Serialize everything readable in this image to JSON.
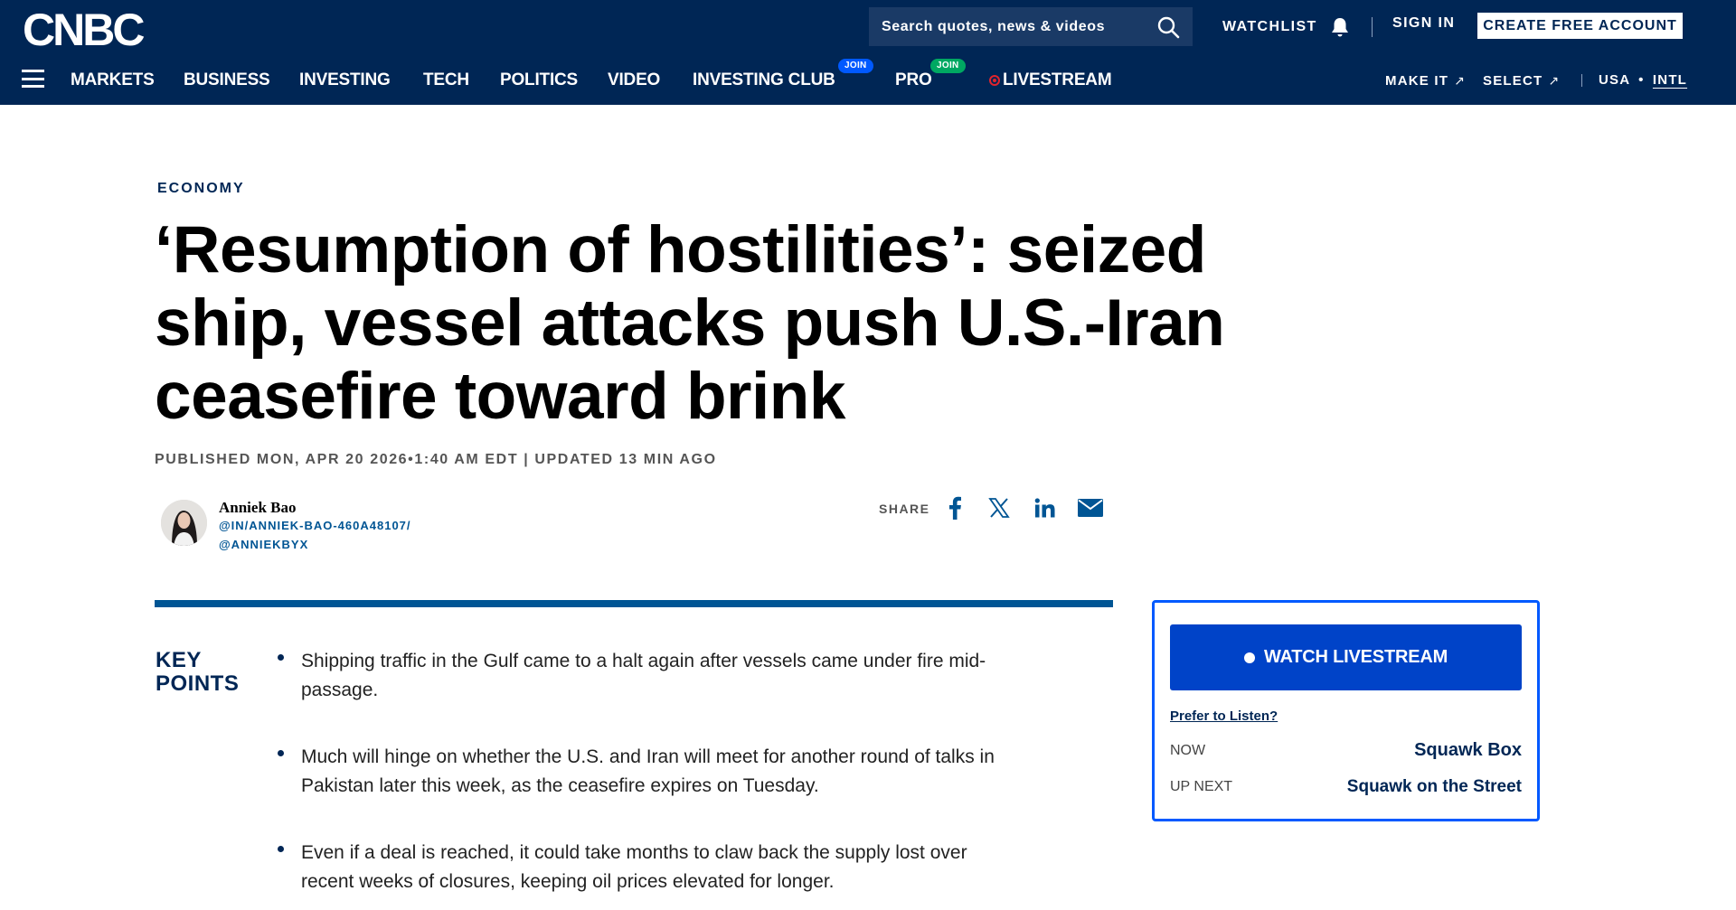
{
  "header": {
    "logo": "CNBC",
    "search": {
      "placeholder": "Search quotes, news & videos",
      "value": ""
    },
    "watchlist_label": "WATCHLIST",
    "signin_label": "SIGN IN",
    "create_account_label": "CREATE FREE ACCOUNT"
  },
  "nav": {
    "items": [
      {
        "label": "MARKETS"
      },
      {
        "label": "BUSINESS"
      },
      {
        "label": "INVESTING"
      },
      {
        "label": "TECH"
      },
      {
        "label": "POLITICS"
      },
      {
        "label": "VIDEO"
      },
      {
        "label": "INVESTING CLUB",
        "badge": "JOIN"
      },
      {
        "label": "PRO",
        "badge": "JOIN"
      },
      {
        "label": "LIVESTREAM"
      }
    ],
    "right": {
      "make_it": "MAKE IT",
      "select": "SELECT",
      "usa": "USA",
      "separator": "•",
      "intl": "INTL"
    }
  },
  "article": {
    "section": "ECONOMY",
    "headline_lines": [
      "‘Resumption of hostilities’: seized",
      "ship, vessel attacks push U.S.-Iran",
      "ceasefire toward brink"
    ],
    "timestamp": "PUBLISHED MON, APR 20 2026•1:40 AM EDT | UPDATED 13 MIN AGO",
    "author": {
      "name": "Anniek Bao",
      "linkedin": "@IN/ANNIEK-BAO-460A48107/",
      "twitter": "@ANNIEKBYX"
    },
    "share_label": "SHARE",
    "key_points_title_1": "KEY",
    "key_points_title_2": "POINTS",
    "key_points": [
      {
        "line1": "Shipping traffic in the Gulf came to a halt again after vessels came under fire mid-",
        "line2": "passage."
      },
      {
        "line1": "Much will hinge on whether the U.S. and Iran will meet for another round of talks in",
        "line2": "Pakistan later this week, as the ceasefire expires on Tuesday."
      },
      {
        "line1": "Even if a deal is reached, it could take months to claw back the supply lost over",
        "line2": "recent weeks of closures, keeping oil prices elevated for longer."
      }
    ]
  },
  "livestream": {
    "button_label": "WATCH LIVESTREAM",
    "prefer_listen": "Prefer to Listen?",
    "now_label": "NOW",
    "now_show": "Squawk Box",
    "next_label": "UP NEXT",
    "next_show": "Squawk on the Street"
  },
  "colors": {
    "header_bg": "#002655",
    "accent_blue": "#0059ff",
    "button_blue": "#0043c8",
    "rule_blue": "#005594",
    "live_red": "#e0242d",
    "join_green": "#00a862"
  },
  "icons": [
    "menu-icon",
    "search-icon",
    "bell-icon",
    "external-arrow-icon",
    "live-dot-icon",
    "facebook-icon",
    "x-icon",
    "linkedin-icon",
    "email-icon"
  ]
}
